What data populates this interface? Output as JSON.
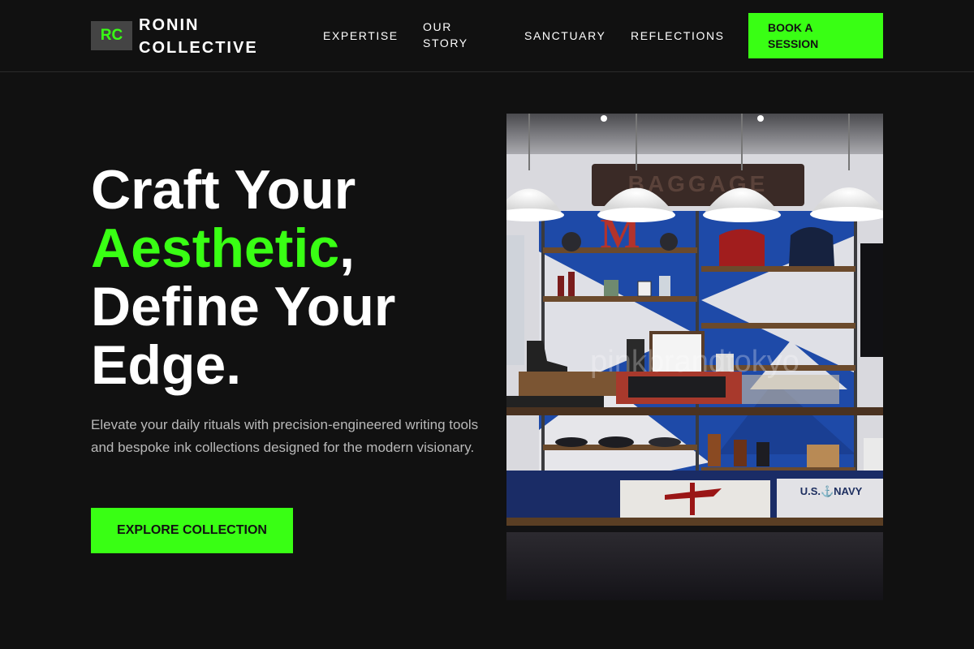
{
  "brand": {
    "mark": "RC",
    "name_line1": "RONIN",
    "name_line2": "COLLECTIVE"
  },
  "nav": {
    "expertise": "EXPERTISE",
    "our_story_line1": "OUR",
    "our_story_line2": "STORY",
    "sanctuary": "SANCTUARY",
    "reflections": "REFLECTIONS",
    "book_line1": "BOOK A",
    "book_line2": "SESSION"
  },
  "hero": {
    "headline_part1": "Craft Your",
    "headline_accent": "Aesthetic",
    "headline_comma": ",",
    "headline_part2": "Define Your",
    "headline_part3": "Edge.",
    "lede": "Elevate your daily rituals with precision-engineered writing tools and bespoke ink collections designed for the modern visionary.",
    "cta": "EXPLORE COLLECTION"
  },
  "photo": {
    "sign_text": "BAGGAGE",
    "watermark": "pinkbrandtokyo",
    "sweatshirt_text": "U.S.⚓NAVY",
    "letter_block": "M"
  },
  "colors": {
    "background": "#111111",
    "accent": "#39ff14",
    "text": "#ffffff",
    "muted_text": "#b9b9b9",
    "logo_bg": "#444444"
  }
}
